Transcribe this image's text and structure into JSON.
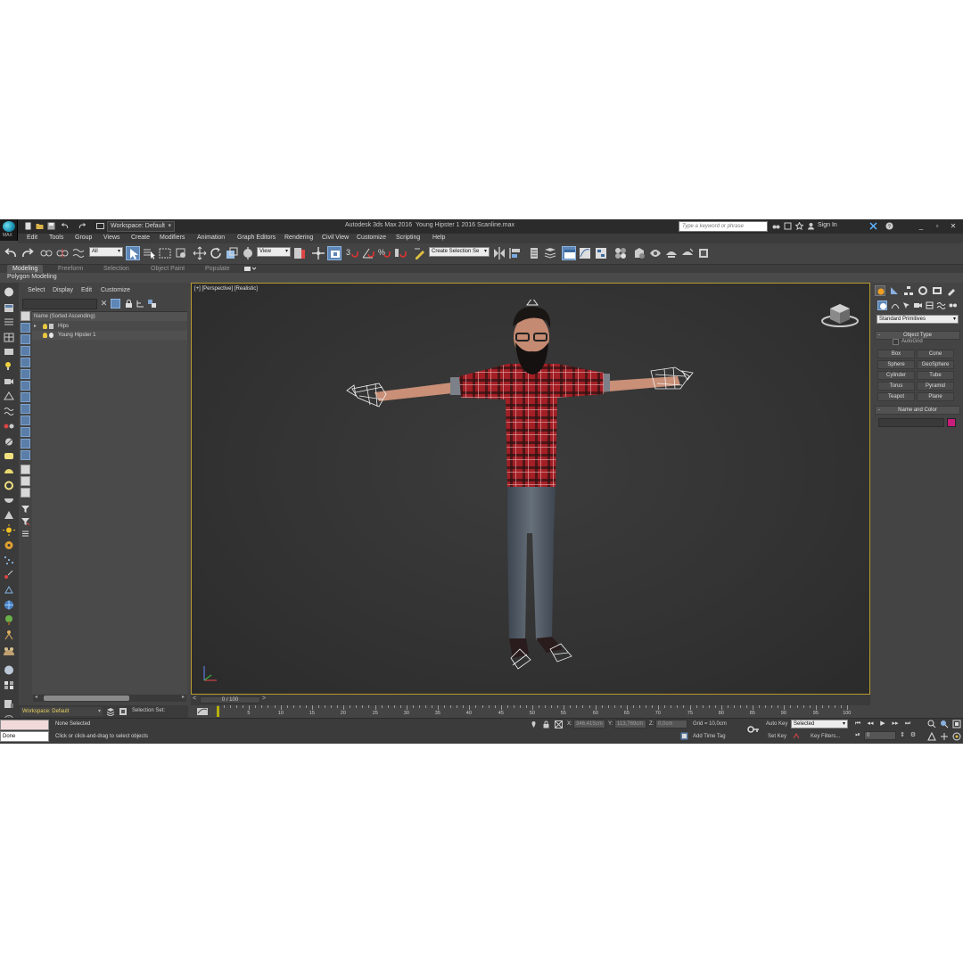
{
  "titlebar": {
    "logo_label": "MAX",
    "workspace": "Workspace: Default",
    "app_title": "Autodesk 3ds Max 2016",
    "doc_title": "Young Hipster 1 2016 Scanline.max",
    "search_placeholder": "Type a keyword or phrase",
    "sign_in": "Sign In"
  },
  "menu": [
    "Edit",
    "Tools",
    "Group",
    "Views",
    "Create",
    "Modifiers",
    "Animation",
    "Graph Editors",
    "Rendering",
    "Civil View",
    "Customize",
    "Scripting",
    "Help"
  ],
  "toolbar": {
    "selection_filter": "All",
    "ref_coord": "View",
    "named_selection": "Create Selection Se"
  },
  "ribbon": {
    "tabs": [
      "Modeling",
      "Freeform",
      "Selection",
      "Object Paint",
      "Populate"
    ],
    "active_tab": "Modeling",
    "sub_label": "Polygon Modeling"
  },
  "explorer": {
    "menu": [
      "Select",
      "Display",
      "Edit",
      "Customize"
    ],
    "column_header": "Name (Sorted Ascending)",
    "rows": [
      "Hips",
      "Young Hipster 1"
    ],
    "workspace": "Workspace: Default",
    "selection_set": "Selection Set:"
  },
  "viewport": {
    "label": "[+] [Perspective] [Realistic]",
    "border_color": "#b79b2e"
  },
  "timeline": {
    "position": "0 / 100",
    "ticks": [
      "5",
      "10",
      "15",
      "20",
      "25",
      "30",
      "35",
      "40",
      "45",
      "50",
      "55",
      "60",
      "65",
      "70",
      "75",
      "80",
      "85",
      "90",
      "95",
      "100"
    ]
  },
  "command_panel": {
    "dropdown": "Standard Primitives",
    "object_type_title": "Object Type",
    "autogrid": "AutoGrid",
    "primitives": [
      "Box",
      "Cone",
      "Sphere",
      "GeoSphere",
      "Cylinder",
      "Tube",
      "Torus",
      "Pyramid",
      "Teapot",
      "Plane"
    ],
    "name_color_title": "Name and Color",
    "object_color": "#c71d7b"
  },
  "status": {
    "maxscript_output": "Done",
    "selection": "None Selected",
    "prompt": "Click or click-and-drag to select objects",
    "x_label": "X:",
    "x_value": "346,415cm",
    "y_label": "Y:",
    "y_value": "113,769cm",
    "z_label": "Z:",
    "z_value": "0,0cm",
    "grid": "Grid = 10,0cm",
    "add_time_tag": "Add Time Tag",
    "auto_key": "Auto Key",
    "set_key": "Set Key",
    "key_mode": "Selected",
    "key_filters": "Key Filters...",
    "frame": "0"
  },
  "colors": {
    "shirt": "#b0242a",
    "jeans": "#4c5561",
    "skin": "#c98f77"
  }
}
